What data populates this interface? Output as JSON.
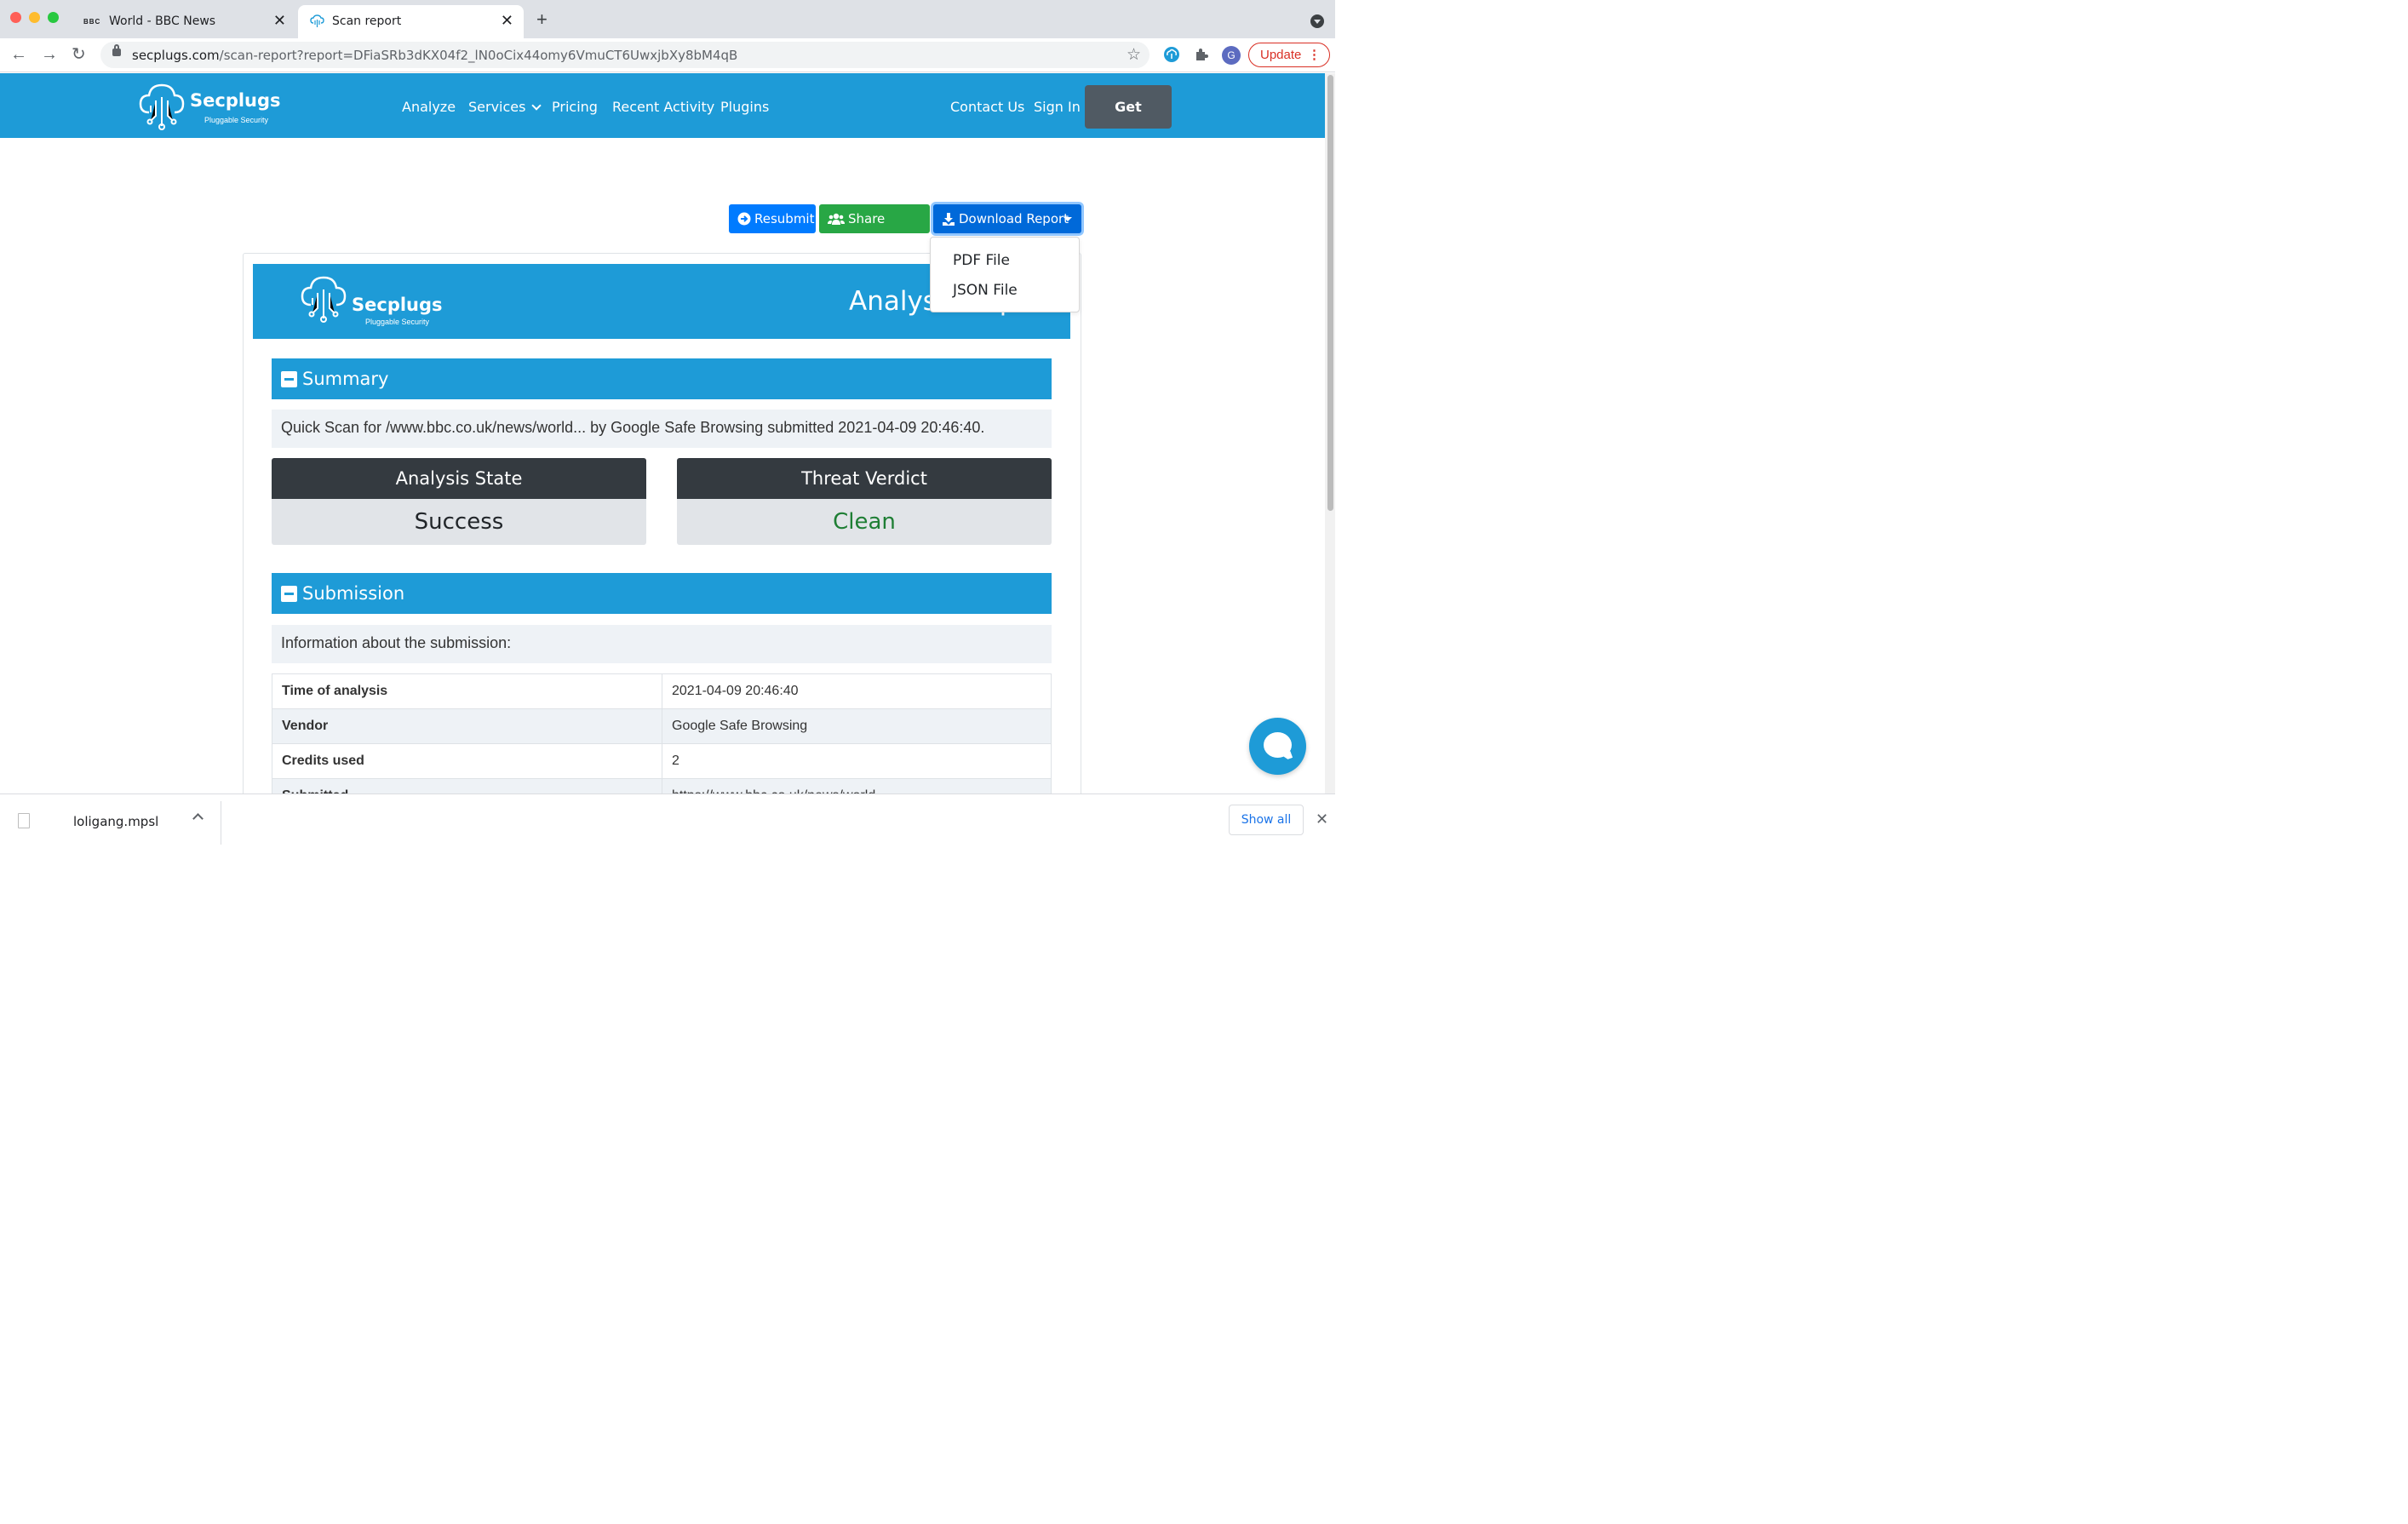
{
  "browser": {
    "tabs": [
      {
        "title": "World - BBC News",
        "favicon": "bbc-logo"
      },
      {
        "title": "Scan report",
        "favicon": "secplugs-cloud-icon"
      }
    ],
    "url_host": "secplugs.com",
    "url_path": "/scan-report?report=DFiaSRb3dKX04f2_lN0oCix44omy6VmuCT6UwxjbXy8bM4qB",
    "profile_initial": "G",
    "update_label": "Update"
  },
  "site": {
    "brand": "Secplugs",
    "tagline": "Pluggable Security",
    "nav": [
      "Analyze",
      "Services",
      "Pricing",
      "Recent Activity",
      "Plugins"
    ],
    "nav_right": [
      "Contact Us",
      "Sign In"
    ],
    "cta": "Get started",
    "accent": "#1e9bd7"
  },
  "actions": {
    "resubmit": "Resubmit",
    "share": "Share Report",
    "download": "Download Report",
    "download_options": [
      "PDF File",
      "JSON File"
    ]
  },
  "report": {
    "title": "Analysis Report",
    "summary": {
      "heading": "Summary",
      "text": "Quick Scan for /www.bbc.co.uk/news/world... by Google Safe Browsing submitted 2021-04-09 20:46:40.",
      "analysis_state_label": "Analysis State",
      "analysis_state": "Success",
      "threat_verdict_label": "Threat Verdict",
      "threat_verdict": "Clean",
      "verdict_color": "#1e7e34"
    },
    "submission": {
      "heading": "Submission",
      "intro": "Information about the submission:",
      "rows": [
        {
          "key": "Time of analysis",
          "value": "2021-04-09 20:46:40"
        },
        {
          "key": "Vendor",
          "value": "Google Safe Browsing"
        },
        {
          "key": "Credits used",
          "value": "2"
        },
        {
          "key": "Submitted",
          "value": "https://www.bbc.co.uk/news/world"
        }
      ]
    }
  },
  "downloads": {
    "file": "loligang.mpsl",
    "show_all": "Show all"
  }
}
